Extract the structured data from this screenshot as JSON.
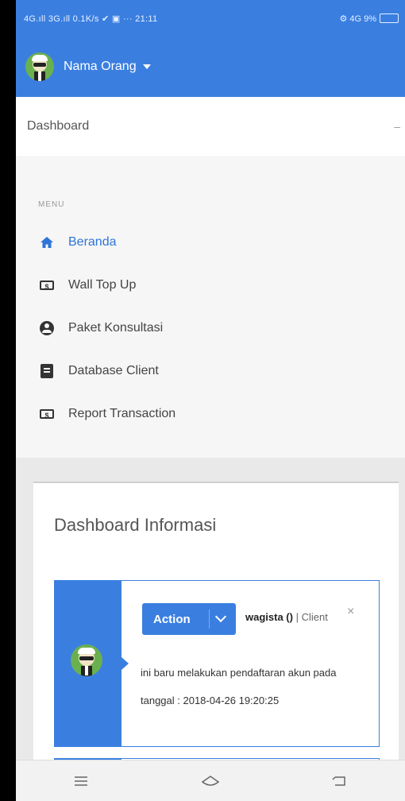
{
  "status_bar": {
    "left_text": "4G.ıll 3G.ıll 0.1K/s ✔ ▣ ··· 21:11",
    "right_text": "⚙ 4G 9%"
  },
  "app_bar": {
    "username": "Nama Orang"
  },
  "dashboard_header": {
    "label": "Dashboard",
    "toggle_icon": "collapse-icon"
  },
  "menu": {
    "title": "MENU",
    "items": [
      {
        "label": "Beranda",
        "icon": "home-icon",
        "active": true
      },
      {
        "label": "Wall Top Up",
        "icon": "money-icon",
        "active": false
      },
      {
        "label": "Paket Konsultasi",
        "icon": "user-circle-icon",
        "active": false
      },
      {
        "label": "Database Client",
        "icon": "address-book-icon",
        "active": false
      },
      {
        "label": "Report Transaction",
        "icon": "money-icon",
        "active": false
      }
    ]
  },
  "main": {
    "card_title": "Dashboard Informasi",
    "timeline": [
      {
        "action_label": "Action",
        "user": "wagista ()",
        "role": "| Client",
        "close_symbol": "×",
        "message": "ini baru melakukan pendaftaran akun pada tanggal : 2018-04-26 19:20:25"
      }
    ]
  },
  "colors": {
    "primary": "#3a7fe0",
    "active_menu": "#2f74d6"
  }
}
